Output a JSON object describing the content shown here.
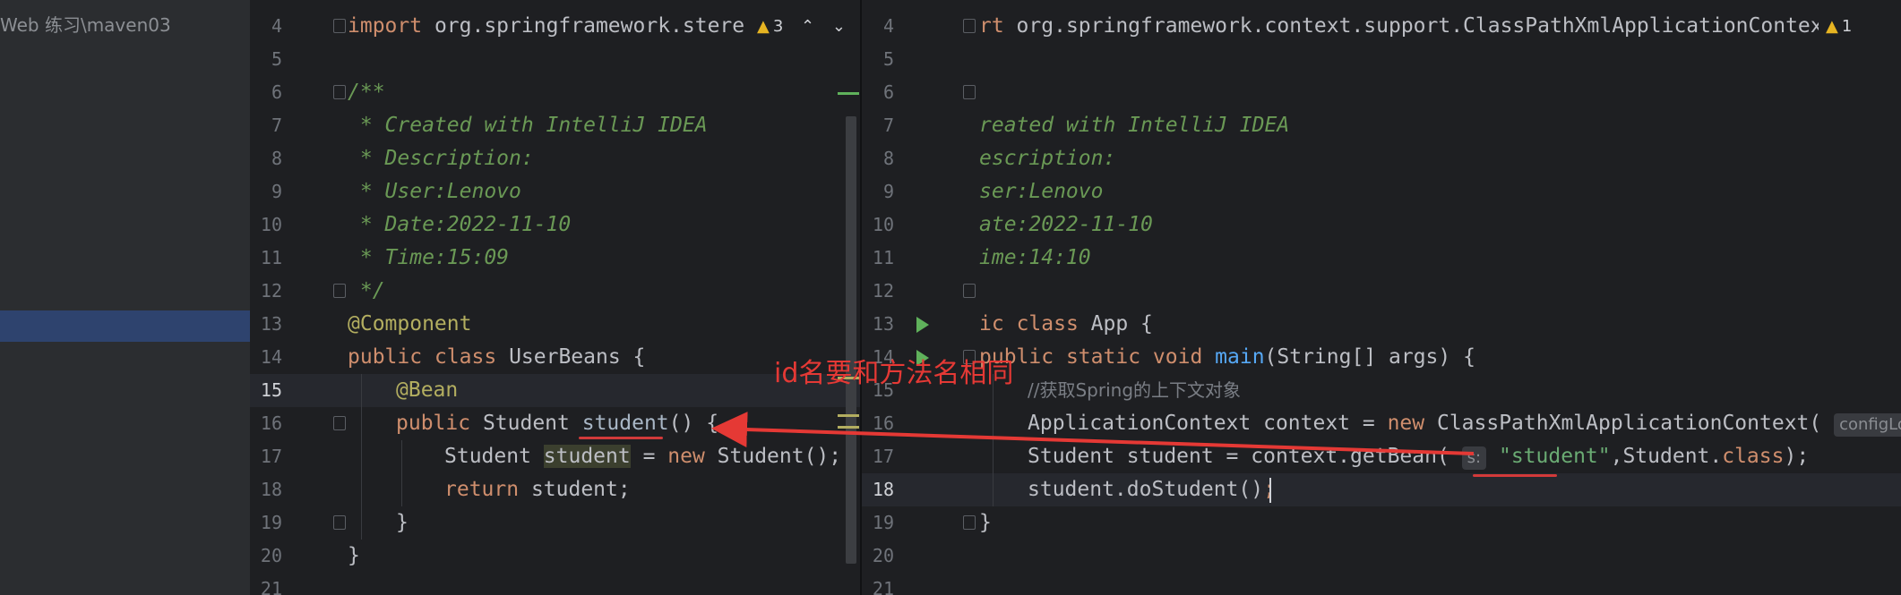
{
  "project_tree": {
    "path_label": "Web 练习\\maven03"
  },
  "left_editor": {
    "warning": {
      "icon": "warning-icon",
      "count": "3"
    },
    "line_numbers": [
      "4",
      "5",
      "6",
      "7",
      "8",
      "9",
      "10",
      "11",
      "12",
      "13",
      "14",
      "15",
      "16",
      "17",
      "18",
      "19",
      "20",
      "21"
    ],
    "current_line": "15",
    "code": {
      "l4_kw": "import",
      "l4_rest": " org.springframework.stere",
      "l6": "/**",
      "l7": " * Created with IntelliJ IDEA",
      "l8": " * Description:",
      "l9": " * User:Lenovo",
      "l10": " * Date:2022-11-10",
      "l11": " * Time:15:09",
      "l12": " */",
      "l13": "@Component",
      "l14_kw1": "public",
      "l14_kw2": "class",
      "l14_name": "UserBeans",
      "l14_brace": " {",
      "l15": "@Bean",
      "l16_kw": "public",
      "l16_type": " Student ",
      "l16_method": "student",
      "l16_rest": "() {",
      "l17_type": "Student ",
      "l17_var": "student",
      "l17_eq": " = ",
      "l17_new": "new",
      "l17_rest": " Student();",
      "l18_kw": "return",
      "l18_rest": " student;",
      "l19": "}",
      "l20": "}"
    }
  },
  "right_editor": {
    "warning": {
      "icon": "warning-icon",
      "count": "1"
    },
    "line_numbers": [
      "4",
      "5",
      "6",
      "7",
      "8",
      "9",
      "10",
      "11",
      "12",
      "13",
      "14",
      "15",
      "16",
      "17",
      "18",
      "19",
      "20",
      "21"
    ],
    "current_line": "18",
    "code": {
      "l4_kw": "rt",
      "l4_rest": " org.springframework.context.support.ClassPathXmlApplicationContext",
      "l7": "reated with IntelliJ IDEA",
      "l8": "escription:",
      "l9": "ser:Lenovo",
      "l10": "ate:2022-11-10",
      "l11": "ime:14:10",
      "l13_kw1": "ic",
      "l13_kw2": "class",
      "l13_rest": " App {",
      "l14_kw1": "public",
      "l14_kw2": "static",
      "l14_kw3": "void",
      "l14_fn": "main",
      "l14_rest": "(String[] args) {",
      "l15": "//获取Spring的上下文对象",
      "l16_a": "ApplicationContext context = ",
      "l16_new": "new",
      "l16_b": " ClassPathXmlApplicationContext(",
      "l16_hint": "configLoc",
      "l17_a": "Student student = context.getBean(",
      "l17_hint": "s:",
      "l17_str": "\"student\"",
      "l17_b": ",Student.",
      "l17_kw": "class",
      "l17_c": ");",
      "l18_a": "student.doStudent()",
      "l18_semi": ";",
      "l19": "}"
    }
  },
  "annotation": {
    "text": "id名要和方法名相同",
    "color": "#e53935"
  }
}
